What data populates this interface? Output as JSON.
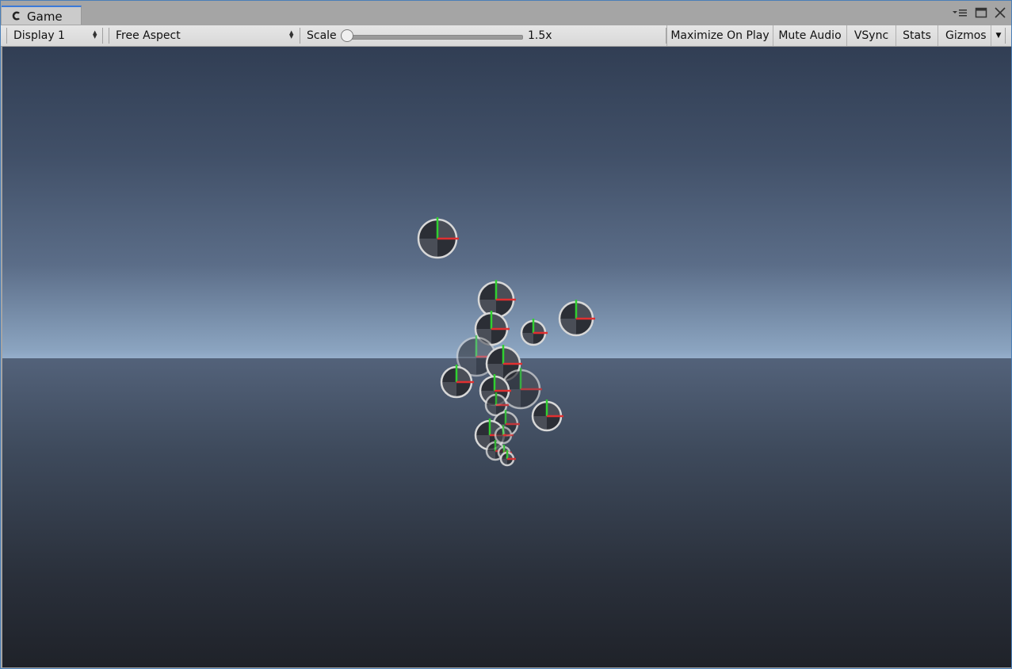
{
  "tab": {
    "title": "Game",
    "icon": "unity-game-icon"
  },
  "window_controls": {
    "menu_icon": "menu-icon",
    "maximize_icon": "maximize-icon",
    "close_icon": "close-icon"
  },
  "toolbar": {
    "display": "Display 1",
    "aspect": "Free Aspect",
    "scale_label": "Scale",
    "scale_value": "1.5x",
    "scale_slider_fraction": 0.0,
    "maximize_on_play": "Maximize On Play",
    "mute_audio": "Mute Audio",
    "vsync": "VSync",
    "stats": "Stats",
    "gizmos": "Gizmos"
  },
  "colors": {
    "sky_top": "#313e54",
    "horizon": "#95aecb",
    "ground_bottom": "#1f2229",
    "axis_x": "#e03030",
    "axis_y": "#30d030",
    "gizmo_ring": "#d8d8d8",
    "tab_accent": "#3a79d8"
  }
}
